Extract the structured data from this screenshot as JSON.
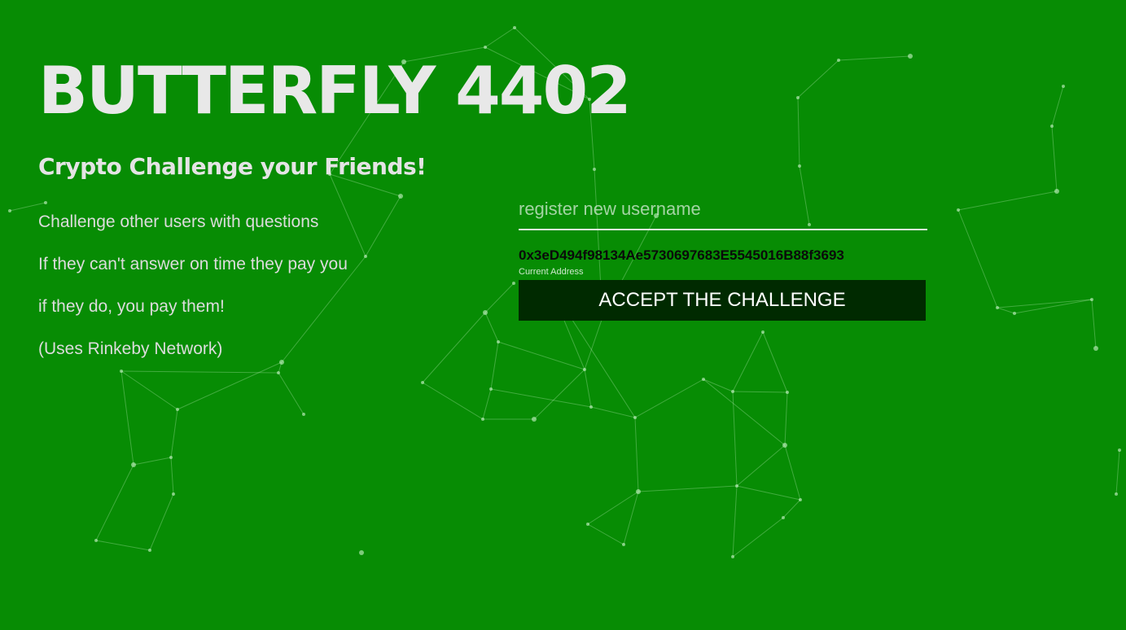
{
  "hero": {
    "title": "BUTTERFLY 4402",
    "subtitle": "Crypto Challenge your Friends!",
    "lines": [
      "Challenge other users with questions",
      "If they can't answer on time they pay you",
      "if they do, you pay them!",
      "(Uses Rinkeby Network)"
    ]
  },
  "form": {
    "username_placeholder": "register new username",
    "username_value": "",
    "address": "0x3eD494f98134Ae5730697683E5545016B88f3693",
    "address_label": "Current Address",
    "accept_label": "ACCEPT THE CHALLENGE"
  },
  "colors": {
    "background": "#078c04",
    "button": "#002a00",
    "network": "#dcffdc"
  }
}
